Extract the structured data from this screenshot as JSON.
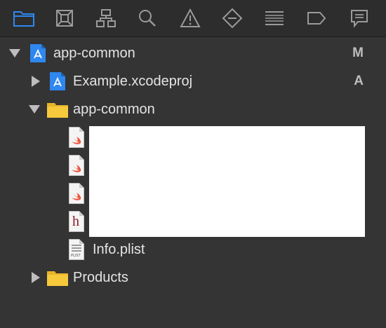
{
  "toolbar": {
    "icons": [
      "folder-icon",
      "source-control-icon",
      "hierarchy-icon",
      "search-icon",
      "warning-icon",
      "test-diamond-icon",
      "list-icon",
      "breakpoint-icon",
      "message-icon"
    ],
    "accent": "#2f87f0",
    "icon_color": "#9a9a9a"
  },
  "tree": {
    "root": {
      "label": "app-common",
      "status": "M"
    },
    "project": {
      "label": "Example.xcodeproj",
      "status": "A"
    },
    "group": {
      "label": "app-common"
    },
    "files": [
      {
        "kind": "swift"
      },
      {
        "kind": "swift"
      },
      {
        "kind": "swift"
      },
      {
        "kind": "header",
        "glyph": "h"
      },
      {
        "kind": "plist",
        "label": "Info.plist",
        "glyph": "PLIST"
      }
    ],
    "products": {
      "label": "Products"
    }
  }
}
